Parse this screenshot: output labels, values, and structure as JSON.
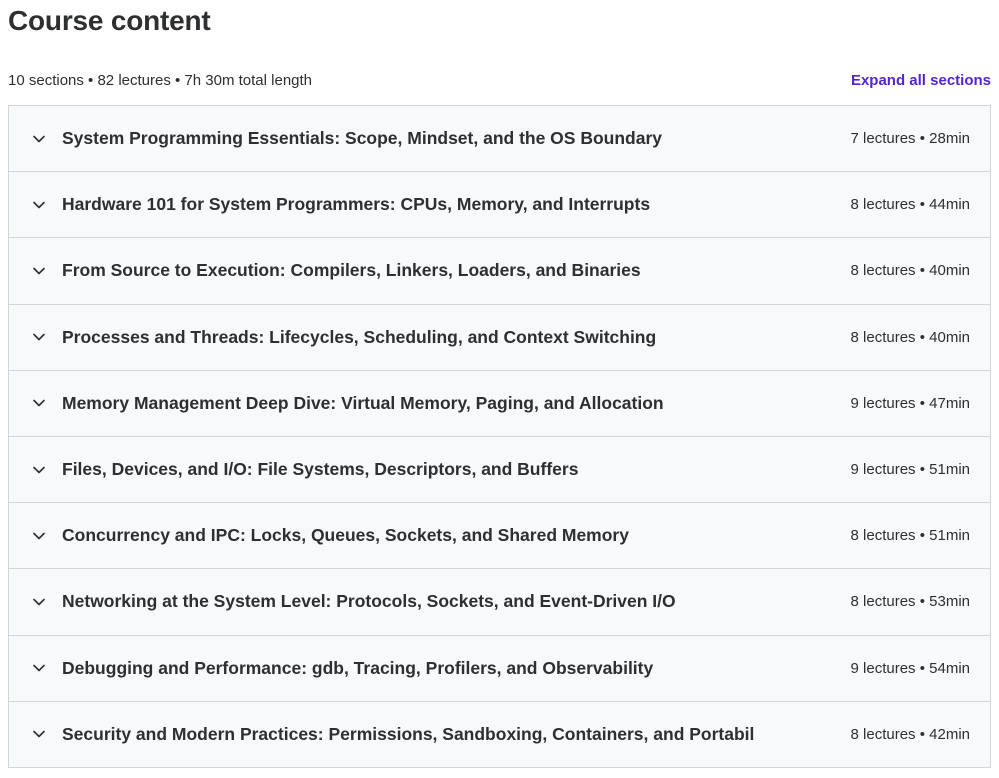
{
  "page": {
    "title": "Course content",
    "summary": "10 sections • 82 lectures • 7h 30m total length",
    "expand_all_label": "Expand all sections"
  },
  "colors": {
    "accent": "#5624d0",
    "text": "#2d2f31",
    "section_bg": "#f7f9fa",
    "border": "#d1d7dc"
  },
  "icons": {
    "section_toggle": "chevron-down-icon"
  },
  "sections": [
    {
      "title": "System Programming Essentials: Scope, Mindset, and the OS Boundary",
      "meta": "7 lectures • 28min"
    },
    {
      "title": "Hardware 101 for System Programmers: CPUs, Memory, and Interrupts",
      "meta": "8 lectures • 44min"
    },
    {
      "title": "From Source to Execution: Compilers, Linkers, Loaders, and Binaries",
      "meta": "8 lectures • 40min"
    },
    {
      "title": "Processes and Threads: Lifecycles, Scheduling, and Context Switching",
      "meta": "8 lectures • 40min"
    },
    {
      "title": "Memory Management Deep Dive: Virtual Memory, Paging, and Allocation",
      "meta": "9 lectures • 47min"
    },
    {
      "title": "Files, Devices, and I/O: File Systems, Descriptors, and Buffers",
      "meta": "9 lectures • 51min"
    },
    {
      "title": "Concurrency and IPC: Locks, Queues, Sockets, and Shared Memory",
      "meta": "8 lectures • 51min"
    },
    {
      "title": "Networking at the System Level: Protocols, Sockets, and Event-Driven I/O",
      "meta": "8 lectures • 53min"
    },
    {
      "title": "Debugging and Performance: gdb, Tracing, Profilers, and Observability",
      "meta": "9 lectures • 54min"
    },
    {
      "title": "Security and Modern Practices: Permissions, Sandboxing, Containers, and Portabil",
      "meta": "8 lectures • 42min"
    }
  ]
}
